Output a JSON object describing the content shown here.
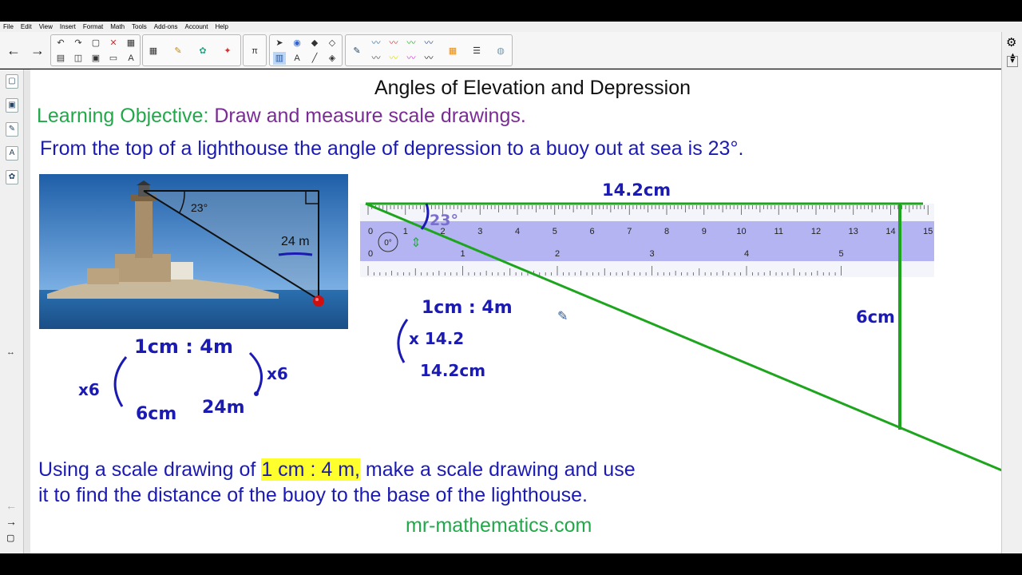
{
  "menu": [
    "File",
    "Edit",
    "View",
    "Insert",
    "Format",
    "Math",
    "Tools",
    "Add-ons",
    "Account",
    "Help"
  ],
  "slide": {
    "title": "Angles of Elevation and Depression",
    "objective_label": "Learning Objective:",
    "objective_text": "Draw and measure scale drawings.",
    "question": "From the top of a lighthouse the angle of depression to a buoy out at sea is 23°.",
    "instruction_pre": "Using a scale drawing of",
    "instruction_highlight": "1 cm : 4 m,",
    "instruction_post": "make a scale drawing and use",
    "instruction_line2": "it to find the distance of the buoy to the base of the lighthouse.",
    "website": "mr-mathematics.com"
  },
  "photo": {
    "angle_label": "23°",
    "height_label": "24 m"
  },
  "ruler": {
    "cm_labels": [
      "0",
      "1",
      "2",
      "3",
      "4",
      "5",
      "6",
      "7",
      "8",
      "9",
      "10",
      "11",
      "12",
      "13",
      "14",
      "15"
    ],
    "inch_labels": [
      "0",
      "1",
      "2",
      "3",
      "4",
      "5"
    ],
    "rotation_label": "0°"
  },
  "annotations": {
    "scale_left": "1cm : 4m",
    "mult_left": "x6",
    "mult_right": "x6",
    "result_cm": "6cm",
    "result_m": "24m",
    "scale_right": "1cm : 4m",
    "mult_14": "x 14.2",
    "result_14": "14.2cm",
    "top_length": "14.2cm",
    "angle_drawn": "23°",
    "vertical_length": "6cm"
  },
  "colors": {
    "ink_blue": "#1b1bb3",
    "ink_green": "#22a84a",
    "ink_purple": "#7a2c95",
    "highlight": "#ffff2e",
    "ruler_fill": "#a8a8f0",
    "draw_green": "#1ea51e"
  }
}
